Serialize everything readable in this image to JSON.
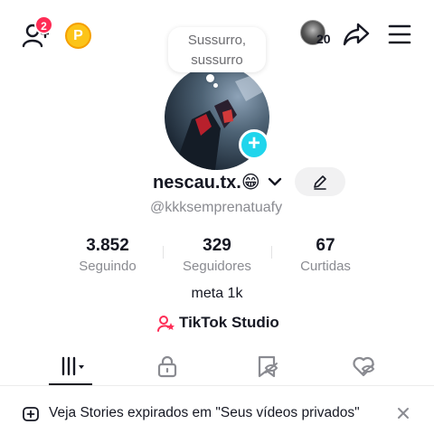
{
  "header": {
    "friend_requests_badge": "2",
    "coin_label": "P",
    "story_count": "20",
    "icons": [
      "add-friend-icon",
      "coin-icon",
      "share-icon",
      "menu-icon"
    ]
  },
  "note": {
    "line1": "Sussurro,",
    "line2": "sussurro"
  },
  "profile": {
    "display_name": "nescau.tx.😁",
    "handle": "@kkksemprenatuafy",
    "add_story_symbol": "+"
  },
  "stats": [
    {
      "value": "3.852",
      "label": "Seguindo"
    },
    {
      "value": "329",
      "label": "Seguidores"
    },
    {
      "value": "67",
      "label": "Curtidas"
    }
  ],
  "bio": "meta 1k",
  "studio_label": "TikTok Studio",
  "tabs": [
    "videos-tab",
    "private-tab",
    "reposts-tab",
    "liked-tab"
  ],
  "banner": {
    "text": "Veja Stories expirados em \"Seus vídeos privados\""
  },
  "colors": {
    "accent_red": "#fe2c55",
    "accent_cyan": "#20d5ec",
    "coin": "#fcc419",
    "text_secondary": "#8a8b91"
  }
}
